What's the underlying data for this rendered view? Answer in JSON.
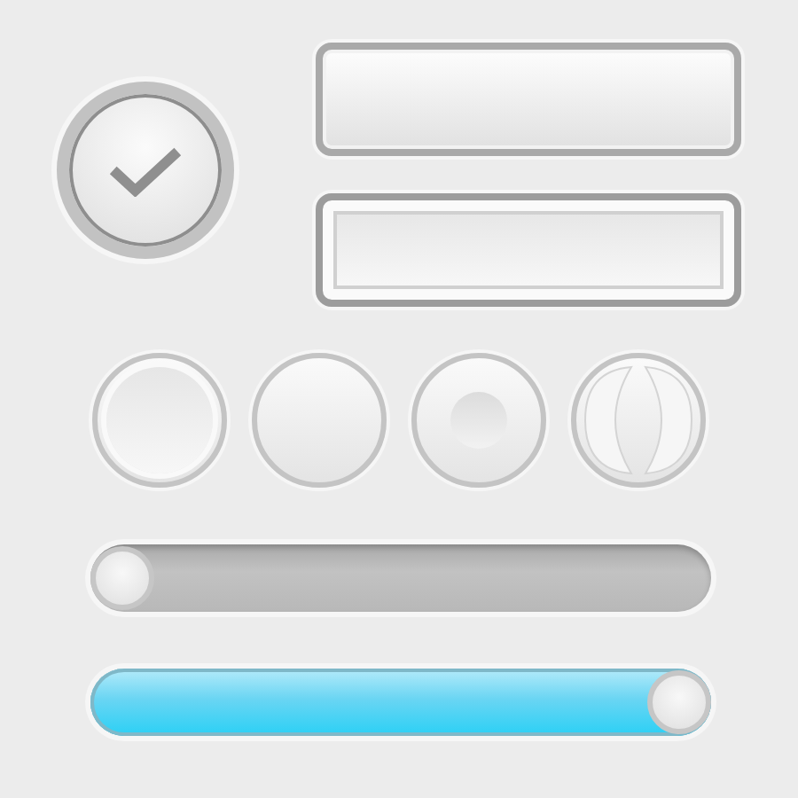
{
  "check_button": {
    "checked": true
  },
  "buttons": [
    {
      "pressed": false
    },
    {
      "pressed": true
    }
  ],
  "round_buttons": [
    {
      "kind": "ring"
    },
    {
      "kind": "plain"
    },
    {
      "kind": "dot"
    },
    {
      "kind": "split"
    }
  ],
  "sliders": [
    {
      "level": 0,
      "active": false
    },
    {
      "level": 1,
      "active": true
    }
  ]
}
